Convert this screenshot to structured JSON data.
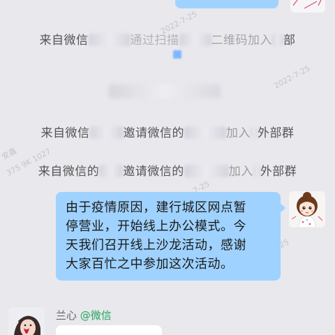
{
  "messages": {
    "notice_1": {
      "prefix": "来自微信",
      "middle": "通过扫描",
      "suffix": "二维码加入",
      "tail": "部"
    },
    "notice_2": {
      "prefix": "来自微信",
      "middle": "邀请微信的",
      "suffix": "加入",
      "tail": "外部群"
    },
    "notice_3": {
      "prefix": "来自微信的",
      "middle": "邀请微信的",
      "suffix": "加入",
      "tail": "外部群"
    },
    "main_bubble": {
      "line1": "由于疫情原因，建行城区网点暂",
      "line2": "停营业，开始线上办公模式。今",
      "line3": "天我们召开线上沙龙活动，感谢",
      "line4": "大家百忙之中参加这次活动。"
    },
    "incoming": {
      "sender_name": "兰心",
      "sender_tag": "@微信"
    }
  },
  "watermarks": {
    "w1": "2022-7-25",
    "w2": "2022-7-25",
    "w3": "安鑫",
    "w4": "375 9K 1027",
    "w5": "7-25",
    "w6": "-7-25"
  },
  "colors": {
    "chat_background": "#e8e8ed",
    "outgoing_bubble": "#9fd2ff",
    "incoming_bubble": "#ffffff",
    "wechat_tag": "#23a35a"
  },
  "icons": {
    "avatar_self": "cartoon-girl-avatar",
    "avatar_sender": "woman-portrait-avatar"
  }
}
